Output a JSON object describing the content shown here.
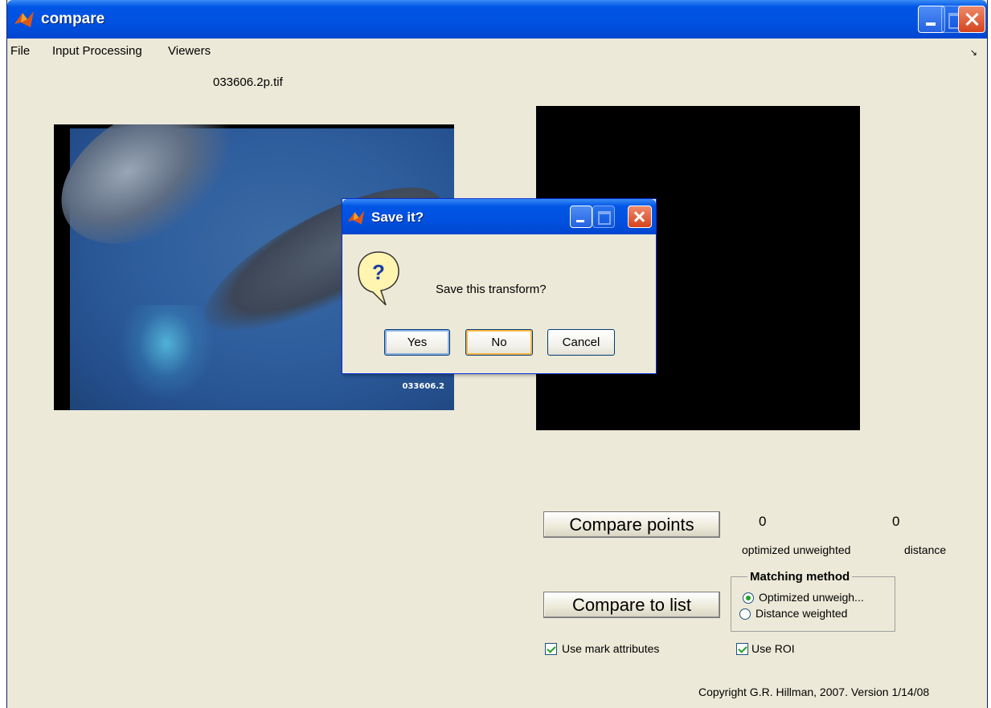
{
  "window": {
    "title": "compare",
    "menu": [
      "File",
      "Input Processing",
      "Viewers"
    ],
    "dock_glyph": "↘"
  },
  "main": {
    "image_filename": "033606.2p.tif",
    "image_stamp": "033606.2",
    "compare_points_label": "Compare points",
    "compare_list_label": "Compare to list",
    "value_optimized": "0",
    "value_distance": "0",
    "label_optimized": "optimized unweighted",
    "label_distance": "distance",
    "matching_method": {
      "legend": "Matching method",
      "options": [
        "Optimized unweigh...",
        "Distance weighted"
      ],
      "selected": 0
    },
    "use_mark_attributes": "Use mark attributes",
    "use_roi": "Use ROI",
    "copyright": "Copyright G.R. Hillman, 2007. Version 1/14/08"
  },
  "dialog": {
    "title": "Save it?",
    "message": "Save this transform?",
    "buttons": [
      "Yes",
      "No",
      "Cancel"
    ],
    "icon": "question-icon"
  },
  "colors": {
    "titlebar": "#0055e5",
    "face": "#ece9d8",
    "check": "#21a121"
  }
}
